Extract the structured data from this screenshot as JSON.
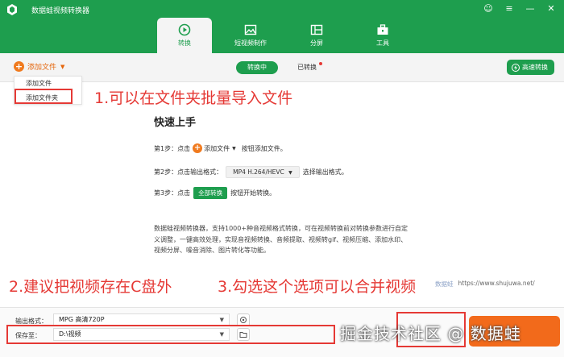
{
  "app": {
    "title": "数据蛙视频转换器",
    "window_controls": [
      "☺",
      "≡",
      "—",
      "✕"
    ]
  },
  "nav": {
    "tabs": [
      {
        "label": "转换",
        "icon": "convert-icon",
        "active": true
      },
      {
        "label": "短视频制作",
        "icon": "image-icon",
        "active": false
      },
      {
        "label": "分屏",
        "icon": "split-screen-icon",
        "active": false
      },
      {
        "label": "工具",
        "icon": "toolbox-icon",
        "active": false
      }
    ]
  },
  "toolbar": {
    "add_file_label": "添加文件",
    "converting_label": "转换中",
    "converted_label": "已转换",
    "fast_convert_label": "高速转换"
  },
  "dropdown": {
    "items": [
      "添加文件",
      "添加文件夹"
    ]
  },
  "annotations": {
    "one": "1.可以在文件夹批量导入文件",
    "two": "2.建议把视频存在C盘外",
    "three": "3.勾选这个选项可以合并视频"
  },
  "quick_start": {
    "title": "快速上手",
    "step1_prefix": "第1步：点击",
    "step1_button": "添加文件",
    "step1_suffix": "按钮添加文件。",
    "step2_prefix": "第2步：点击输出格式：",
    "step2_select": "MP4 H.264/HEVC",
    "step2_suffix": "选择输出格式。",
    "step3_prefix": "第3步：点击",
    "step3_button": "全部转换",
    "step3_suffix": "按钮开始转换。",
    "description": "数据蛙视频转换器，支持1000+种音视频格式转换，可在视频转换前对转换参数进行自定义调整，一键高效处理，实现音视频转换、音频提取、视频转gif、视频压缩、添加水印、视频分屏、噪音消除、图片转化等功能。"
  },
  "brand": {
    "name": "数据蛙",
    "url": "https://www.shujuwa.net/"
  },
  "bottom": {
    "output_format_label": "输出格式：",
    "output_format_value": "MPG 高清720P",
    "save_to_label": "保存至：",
    "save_to_value": "D:\\视频"
  },
  "watermark": "掘金技术社区 @ 数据蛙",
  "colors": {
    "brand_green": "#1e9e4e",
    "accent_orange": "#f07a1e",
    "annotation_red": "#e53935"
  }
}
